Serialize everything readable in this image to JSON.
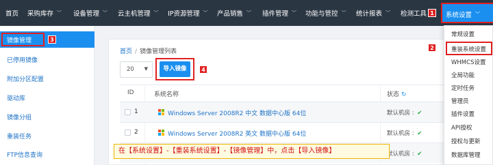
{
  "topnav": {
    "items": [
      {
        "label": "首页",
        "chevron": false
      },
      {
        "label": "采购库存",
        "chevron": true
      },
      {
        "label": "设备管理",
        "chevron": true
      },
      {
        "label": "云主机管理",
        "chevron": true
      },
      {
        "label": "IP资源管理",
        "chevron": true
      },
      {
        "label": "产品销售",
        "chevron": true
      },
      {
        "label": "插件管理",
        "chevron": true
      },
      {
        "label": "功能与管控",
        "chevron": true
      },
      {
        "label": "统计报表",
        "chevron": true
      },
      {
        "label": "检测工具",
        "chevron": false
      }
    ],
    "active": {
      "label": "系统设置"
    },
    "chevron_glyph": "﹀"
  },
  "sidebar": {
    "items": [
      {
        "label": "镜像管理",
        "active": true
      },
      {
        "label": "已停用镜像"
      },
      {
        "label": "附加分区配置"
      },
      {
        "label": "驱动库"
      },
      {
        "label": "镜像分组"
      },
      {
        "label": "重装任务"
      },
      {
        "label": "FTP信息查询"
      }
    ]
  },
  "breadcrumb": {
    "home": "首页",
    "separator": "/",
    "current": "镜像管理列表"
  },
  "page_size": {
    "value": "20"
  },
  "import_button": {
    "label": "导入镜像"
  },
  "table": {
    "headers": {
      "id": "ID",
      "name": "系统名称",
      "status": "状态"
    },
    "rows": [
      {
        "id": "1",
        "name": "Windows Server 2008R2 中文 数据中心版 64位",
        "status": "默认机房 : "
      },
      {
        "id": "2",
        "name": "Windows Server 2008R2 英文 数据中心版 64位",
        "status": "默认机房 : "
      },
      {
        "id": "",
        "name": "",
        "status": "默认机房 : "
      }
    ]
  },
  "dropdown": {
    "items": [
      "常规设置",
      "重装系统设置",
      "WHMCS设置",
      "全局功能",
      "定时任务",
      "管理员",
      "插件设置",
      "API授权",
      "授权与更新",
      "数据库管理"
    ]
  },
  "markers": [
    "1",
    "2",
    "3",
    "4"
  ],
  "tooltip": {
    "text": "在【系统设置】-【重装系统设置】-【镜像管理】中，点击【导入镜像】"
  },
  "colors": {
    "nav_bg": "#2b3643",
    "accent": "#1b8ff0",
    "highlight": "#e02020",
    "link": "#1e73c6"
  }
}
